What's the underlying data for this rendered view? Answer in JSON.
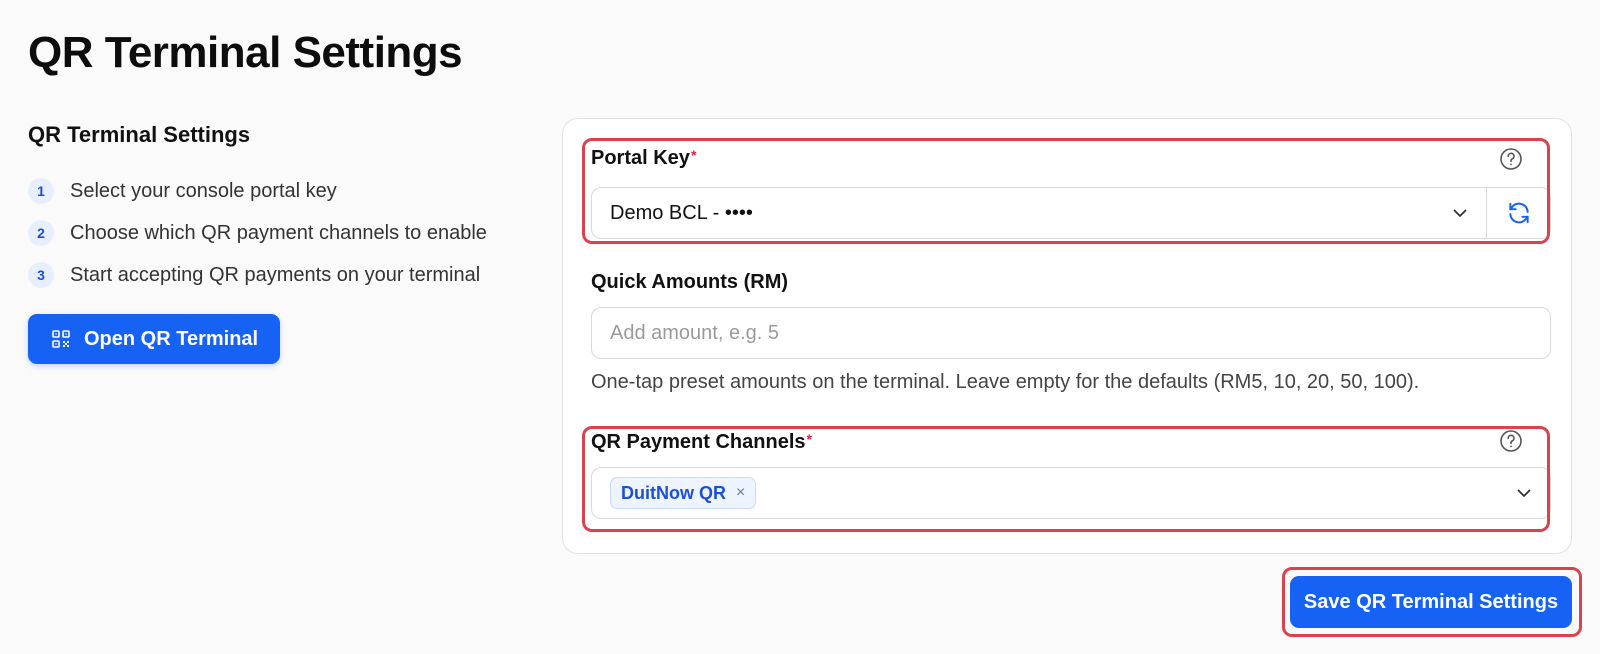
{
  "page": {
    "title": "QR Terminal Settings"
  },
  "left": {
    "heading": "QR Terminal Settings",
    "steps": [
      {
        "num": "1",
        "text": "Select your console portal key"
      },
      {
        "num": "2",
        "text": "Choose which QR payment channels to enable"
      },
      {
        "num": "3",
        "text": "Start accepting QR payments on your terminal"
      }
    ],
    "open_button": {
      "label": "Open QR Terminal",
      "icon": "qr-code-icon"
    }
  },
  "form": {
    "portal_key": {
      "label": "Portal Key",
      "required_mark": "*",
      "value": "Demo BCL - ••••",
      "help_icon": "question-circle-icon",
      "refresh_icon": "refresh-icon"
    },
    "quick_amounts": {
      "label": "Quick Amounts (RM)",
      "value": "",
      "placeholder": "Add amount, e.g. 5",
      "hint": "One-tap preset amounts on the terminal. Leave empty for the defaults (RM5, 10, 20, 50, 100)."
    },
    "payment_channels": {
      "label": "QR Payment Channels",
      "required_mark": "*",
      "selected": [
        {
          "label": "DuitNow QR",
          "remove": "×"
        }
      ],
      "help_icon": "question-circle-icon"
    }
  },
  "save_button": {
    "label": "Save QR Terminal Settings"
  },
  "colors": {
    "accent": "#1662f5",
    "highlight": "#d9434e",
    "required": "#e11d48",
    "background": "#fafafa"
  }
}
